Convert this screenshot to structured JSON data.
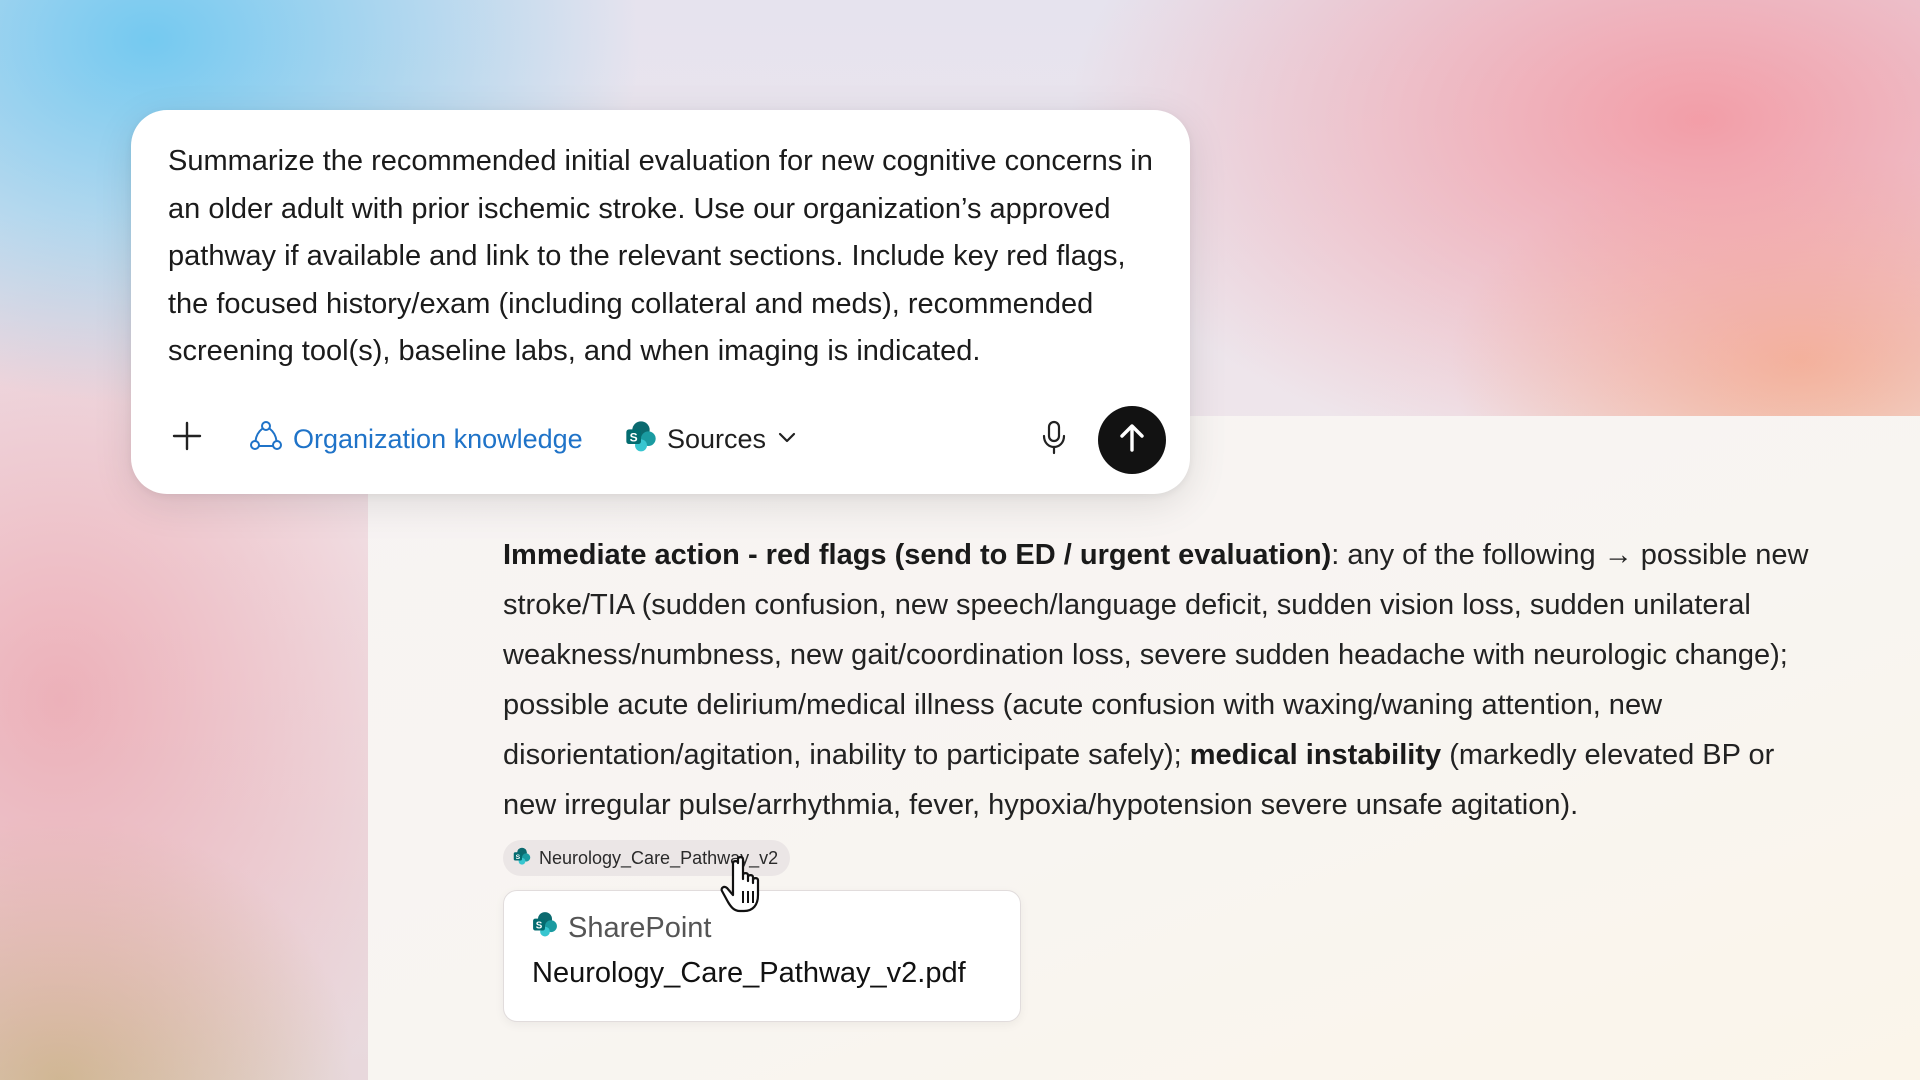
{
  "prompt": {
    "text": "Summarize the recommended initial evaluation for new cognitive concerns in an older adult with prior ischemic stroke. Use our organization’s approved pathway if available and link to the relevant sections. Include key red flags, the focused history/exam (including collateral and meds), recommended screening tool(s), baseline labs, and when imaging is indicated.",
    "toolbar": {
      "add_icon": "plus-icon",
      "org_knowledge_label": "Organization knowledge",
      "org_knowledge_icon": "org-network-icon",
      "sources_label": "Sources",
      "sources_icon": "sharepoint-icon",
      "sources_chevron_icon": "chevron-down-icon",
      "mic_icon": "microphone-icon",
      "send_icon": "arrow-up-icon"
    }
  },
  "answer": {
    "p1_bold": "Immediate action - red flags (send to ED / urgent evaluation)",
    "p1_text": ": any of the following → possible new stroke/TIA (sudden confusion, new speech/language deficit, sudden vision loss, sudden unilateral weakness/numbness, new gait/coordination loss, severe sudden headache with neurologic change); possible acute delirium/medical illness (acute confusion with waxing/waning attention, new disorientation/agitation, inability to participate safely); ",
    "p2_bold": "medical instability",
    "p2_text": " (markedly elevated BP or new irregular pulse/arrhythmia, fever, hypoxia/hypotension severe unsafe agitation)."
  },
  "citation": {
    "label": "Neurology_Care_Pathway_v2",
    "icon": "sharepoint-icon"
  },
  "source_card": {
    "source_name": "SharePoint",
    "icon": "sharepoint-icon",
    "filename": "Neurology_Care_Pathway_v2.pdf"
  },
  "colors": {
    "accent_link": "#1f73c8",
    "send_button": "#121212",
    "sharepoint_teal": "#10868a"
  }
}
